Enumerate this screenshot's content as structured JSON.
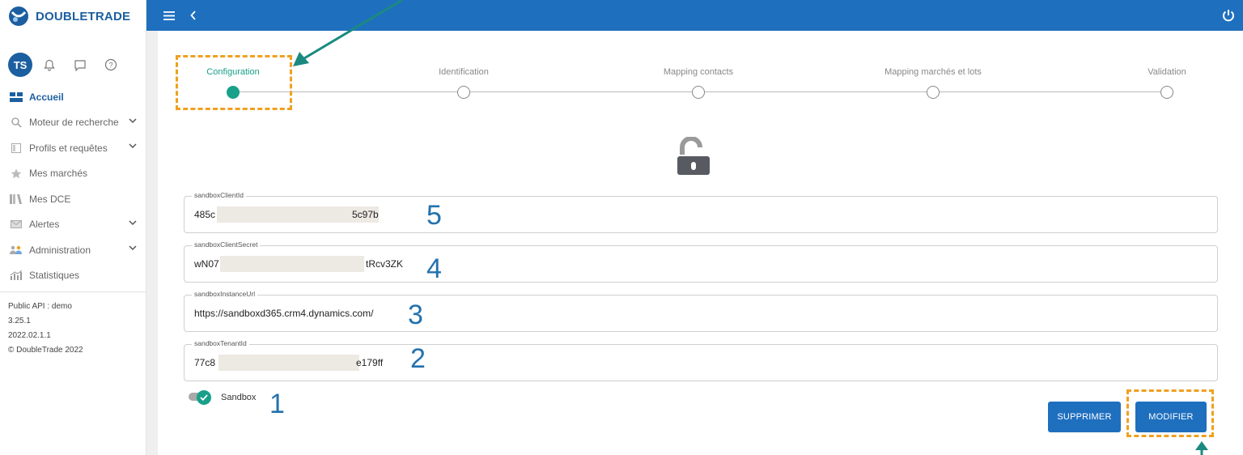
{
  "app": {
    "logo_text": "DOUBLETRADE"
  },
  "user": {
    "initials": "TS"
  },
  "sidebar": {
    "items": [
      {
        "label": "Accueil",
        "icon": "home-grid-icon",
        "active": true,
        "expandable": false
      },
      {
        "label": "Moteur de recherche",
        "icon": "search-icon",
        "active": false,
        "expandable": true
      },
      {
        "label": "Profils et requêtes",
        "icon": "profile-list-icon",
        "active": false,
        "expandable": true
      },
      {
        "label": "Mes marchés",
        "icon": "star-icon",
        "active": false,
        "expandable": false
      },
      {
        "label": "Mes DCE",
        "icon": "books-icon",
        "active": false,
        "expandable": false
      },
      {
        "label": "Alertes",
        "icon": "envelope-icon",
        "active": false,
        "expandable": true
      },
      {
        "label": "Administration",
        "icon": "users-icon",
        "active": false,
        "expandable": true
      },
      {
        "label": "Statistiques",
        "icon": "bar-chart-icon",
        "active": false,
        "expandable": false
      }
    ],
    "version_lines": [
      "Public API : demo",
      "3.25.1",
      "2022.02.1.1",
      "© DoubleTrade 2022"
    ]
  },
  "stepper": {
    "steps": [
      {
        "label": "Configuration",
        "active": true
      },
      {
        "label": "Identification",
        "active": false
      },
      {
        "label": "Mapping contacts",
        "active": false
      },
      {
        "label": "Mapping marchés et lots",
        "active": false
      },
      {
        "label": "Validation",
        "active": false
      }
    ]
  },
  "form": {
    "fields": [
      {
        "label": "sandboxClientId",
        "value_start": "485c",
        "value_end": "5c97b",
        "annotation": "5"
      },
      {
        "label": "sandboxClientSecret",
        "value_start": "wN07",
        "value_end": "tRcv3ZK",
        "annotation": "4"
      },
      {
        "label": "sandboxInstanceUrl",
        "value_start": "https://sandboxd365.crm4.dynamics.com/",
        "value_end": "",
        "annotation": "3"
      },
      {
        "label": "sandboxTenantId",
        "value_start": "77c8",
        "value_end": "e179ff",
        "annotation": "2"
      }
    ],
    "sandbox": {
      "label": "Sandbox",
      "checked": true,
      "annotation": "1"
    }
  },
  "actions": {
    "delete_label": "SUPPRIMER",
    "modify_label": "MODIFIER"
  },
  "colors": {
    "primary": "#1f6fbf",
    "accent": "#18a08a",
    "highlight": "#f0a020",
    "annotation": "#2372ad"
  }
}
